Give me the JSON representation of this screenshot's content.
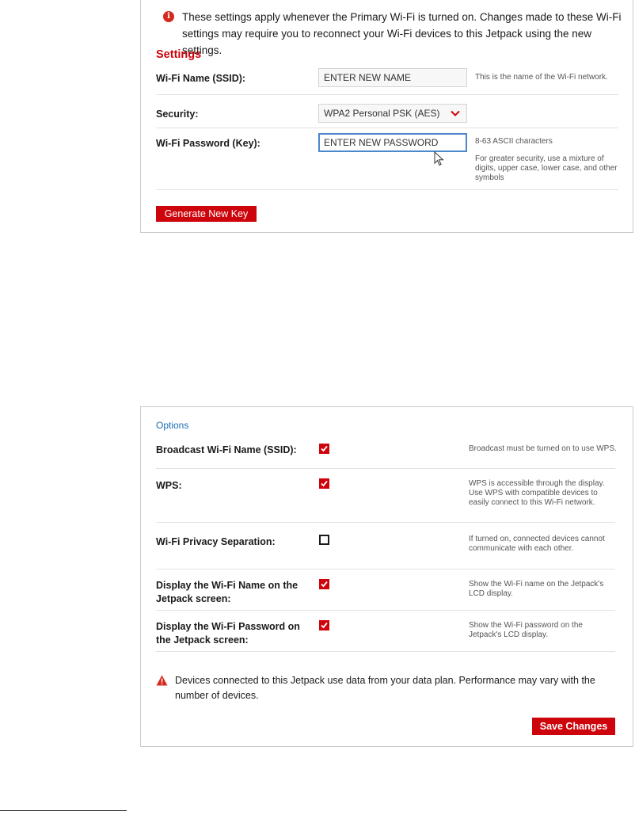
{
  "settings_panel": {
    "info_icon": "info-icon",
    "info_text": "These settings apply whenever the Primary Wi-Fi is turned on. Changes made to these Wi-Fi settings may require you to reconnect your Wi-Fi devices to this Jetpack using the new settings.",
    "title": "Settings",
    "ssid": {
      "label": "Wi-Fi Name (SSID):",
      "value": "ENTER NEW NAME",
      "help": "This is the name of the Wi-Fi network."
    },
    "security": {
      "label": "Security:",
      "selected": "WPA2 Personal PSK (AES)",
      "icon": "chevron-down-icon"
    },
    "password": {
      "label": "Wi-Fi Password (Key):",
      "value": "ENTER NEW PASSWORD",
      "help_1": "8-63 ASCII characters",
      "help_2": "For greater security, use a mixture of digits, upper case, lower case, and other symbols"
    },
    "generate_key_label": "Generate New Key"
  },
  "options_panel": {
    "title": "Options",
    "rows": [
      {
        "label": "Broadcast Wi-Fi Name (SSID):",
        "checked": true,
        "help": "Broadcast must be turned on to use WPS."
      },
      {
        "label": "WPS:",
        "checked": true,
        "help": "WPS is accessible through the display. Use WPS with compatible devices to easily connect to this Wi-Fi network."
      },
      {
        "label": "Wi-Fi Privacy Separation:",
        "checked": false,
        "help": "If turned on, connected devices cannot communicate with each other."
      },
      {
        "label": "Display the Wi-Fi Name on the Jetpack screen:",
        "checked": true,
        "help": "Show the Wi-Fi name on the Jetpack's LCD display."
      },
      {
        "label": "Display the Wi-Fi Password on the Jetpack screen:",
        "checked": true,
        "help": "Show the Wi-Fi password on the Jetpack's LCD display."
      }
    ],
    "warning_icon": "warning-icon",
    "warning_text": "Devices connected to this Jetpack use data from your data plan. Performance may vary with the number of devices.",
    "save_label": "Save Changes"
  },
  "colors": {
    "accent_red": "#cd040b",
    "options_title_blue": "#1a6fb6",
    "focus_border": "#4c87c9"
  }
}
